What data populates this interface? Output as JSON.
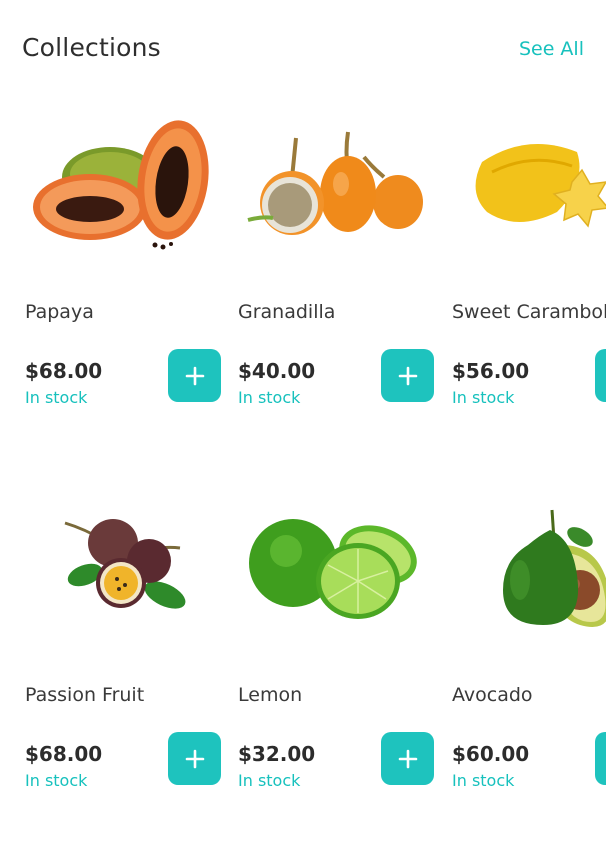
{
  "header": {
    "title": "Collections",
    "see_all_label": "See All"
  },
  "colors": {
    "accent": "#1ec3be",
    "accent_text": "#17c1bd",
    "text_dark": "#2c2c2c"
  },
  "products": [
    {
      "name": "Papaya",
      "price": "$68.00",
      "stock": "In stock",
      "icon": "papaya-image"
    },
    {
      "name": "Granadilla",
      "price": "$40.00",
      "stock": "In stock",
      "icon": "granadilla-image"
    },
    {
      "name": "Sweet Carambola",
      "price": "$56.00",
      "stock": "In stock",
      "icon": "carambola-image"
    },
    {
      "name": "Passion Fruit",
      "price": "$68.00",
      "stock": "In stock",
      "icon": "passion-fruit-image"
    },
    {
      "name": "Lemon",
      "price": "$32.00",
      "stock": "In stock",
      "icon": "lemon-image"
    },
    {
      "name": "Avocado",
      "price": "$60.00",
      "stock": "In stock",
      "icon": "avocado-image"
    }
  ]
}
